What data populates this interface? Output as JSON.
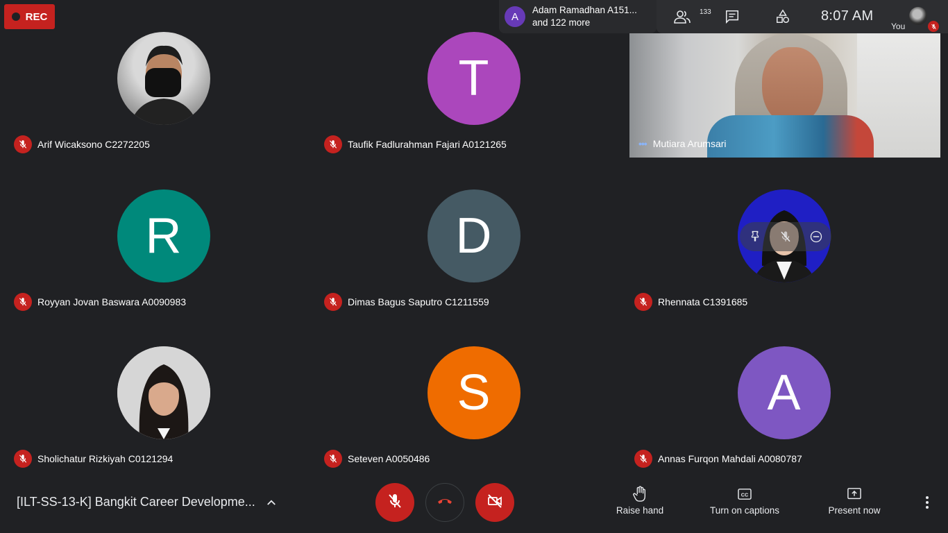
{
  "rec": {
    "label": "REC"
  },
  "presenter": {
    "initial": "A",
    "name": "Adam Ramadhan A151...",
    "more": "and 122 more",
    "color": "#673ab7"
  },
  "topbar": {
    "participant_count": "133",
    "time": "8:07  AM",
    "you_label": "You"
  },
  "tiles": [
    {
      "name": "Arif Wicaksono C2272205",
      "initial": "",
      "color": "#4a4a4a",
      "photo": true,
      "muted": true
    },
    {
      "name": "Taufik Fadlurahman Fajari A0121265",
      "initial": "T",
      "color": "#ab47bc",
      "photo": false,
      "muted": true
    },
    {
      "name": "Mutiara Arumsari",
      "initial": "",
      "color": "",
      "photo": false,
      "video": true,
      "muted": false
    },
    {
      "name": "Royyan Jovan Baswara A0090983",
      "initial": "R",
      "color": "#00897b",
      "photo": false,
      "muted": true
    },
    {
      "name": "Dimas Bagus Saputro C1211559",
      "initial": "D",
      "color": "#455a64",
      "photo": false,
      "muted": true
    },
    {
      "name": "Rhennata C1391685",
      "initial": "",
      "color": "#1e1ec8",
      "photo": true,
      "muted": true
    },
    {
      "name": "Sholichatur Rizkiyah C0121294",
      "initial": "",
      "color": "#cfcfcf",
      "photo": true,
      "muted": true
    },
    {
      "name": "Seteven A0050486",
      "initial": "S",
      "color": "#ef6c00",
      "photo": false,
      "muted": true
    },
    {
      "name": "Annas Furqon Mahdali A0080787",
      "initial": "A",
      "color": "#7e57c2",
      "photo": false,
      "muted": true
    }
  ],
  "bottom": {
    "meeting_title": "[ILT-SS-13-K] Bangkit Career Developme...",
    "raise_hand": "Raise hand",
    "captions": "Turn on captions",
    "present": "Present now"
  },
  "colors": {
    "accent_red": "#c5221f",
    "background": "#202124"
  }
}
